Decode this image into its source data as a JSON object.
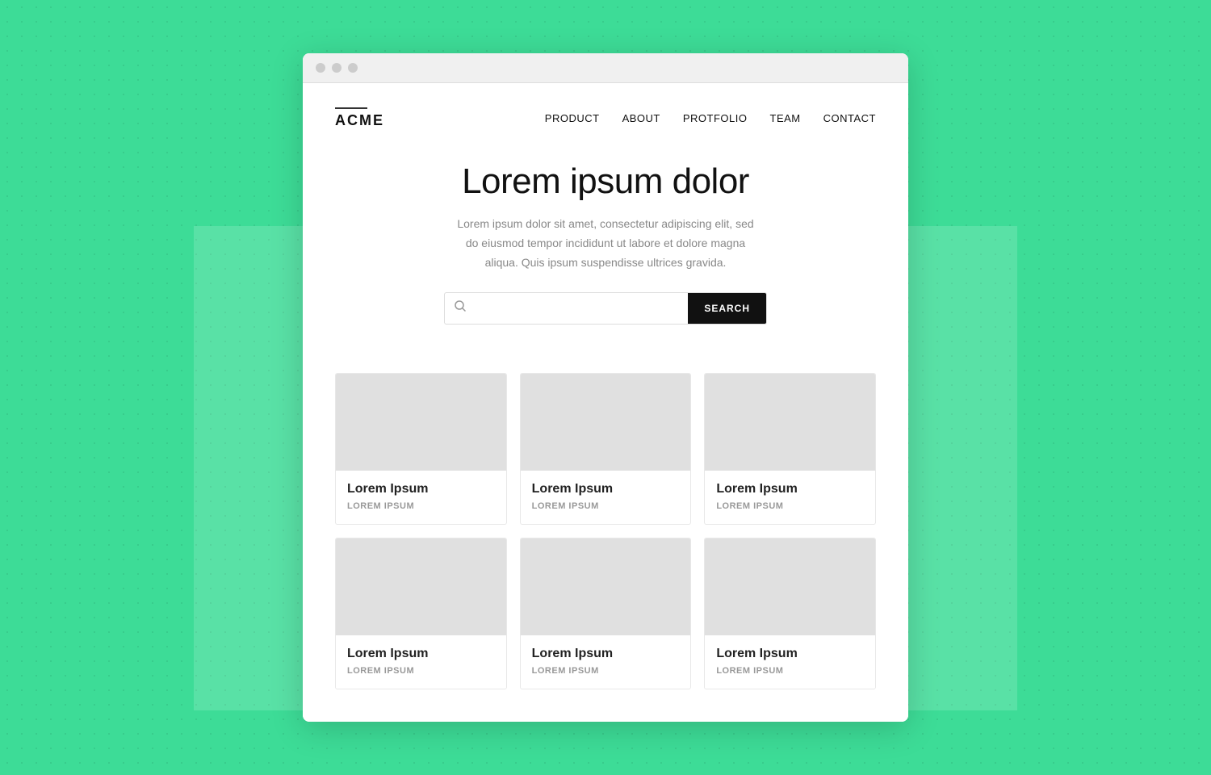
{
  "background": {
    "color": "#3ddc97"
  },
  "browser": {
    "dots": [
      "dot1",
      "dot2",
      "dot3"
    ]
  },
  "nav": {
    "logo": "ACME",
    "links": [
      {
        "id": "product",
        "label": "PRODUCT"
      },
      {
        "id": "about",
        "label": "ABOUT"
      },
      {
        "id": "portfoilio",
        "label": "PROTFOLIO"
      },
      {
        "id": "team",
        "label": "TEAM"
      },
      {
        "id": "contact",
        "label": "CONTACT"
      }
    ]
  },
  "hero": {
    "title": "Lorem ipsum dolor",
    "description": "Lorem ipsum dolor sit amet, consectetur adipiscing elit, sed do eiusmod tempor incididunt ut labore et dolore magna aliqua. Quis ipsum suspendisse ultrices gravida."
  },
  "search": {
    "placeholder": "",
    "button_label": "SEARCH"
  },
  "cards": [
    {
      "id": "card-1",
      "title": "Lorem Ipsum",
      "subtitle": "LOREM IPSUM"
    },
    {
      "id": "card-2",
      "title": "Lorem Ipsum",
      "subtitle": "LOREM IPSUM"
    },
    {
      "id": "card-3",
      "title": "Lorem Ipsum",
      "subtitle": "LOREM IPSUM"
    },
    {
      "id": "card-4",
      "title": "Lorem Ipsum",
      "subtitle": "LOREM IPSUM"
    },
    {
      "id": "card-5",
      "title": "Lorem Ipsum",
      "subtitle": "LOREM IPSUM"
    },
    {
      "id": "card-6",
      "title": "Lorem Ipsum",
      "subtitle": "LOREM IPSUM"
    }
  ]
}
